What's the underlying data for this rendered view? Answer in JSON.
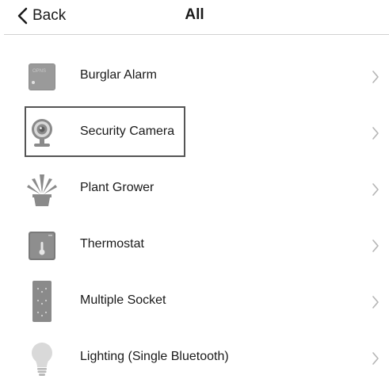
{
  "header": {
    "back_label": "Back",
    "title": "All"
  },
  "list": {
    "selected_index": 1,
    "items": [
      {
        "label": "Burglar Alarm",
        "icon": "burglar-alarm-icon"
      },
      {
        "label": "Security Camera",
        "icon": "security-camera-icon"
      },
      {
        "label": "Plant Grower",
        "icon": "plant-grower-icon"
      },
      {
        "label": "Thermostat",
        "icon": "thermostat-icon"
      },
      {
        "label": "Multiple Socket",
        "icon": "multiple-socket-icon"
      },
      {
        "label": "Lighting (Single Bluetooth)",
        "icon": "lighting-bulb-icon"
      }
    ],
    "burglar_alarm_icon_text": "OPNS"
  },
  "colors": {
    "text": "#1a1a1a",
    "divider": "#d2d2d2",
    "chevron": "#b5b5b5",
    "selection_border": "#555555",
    "icon_gray": "#8a8a8a"
  }
}
